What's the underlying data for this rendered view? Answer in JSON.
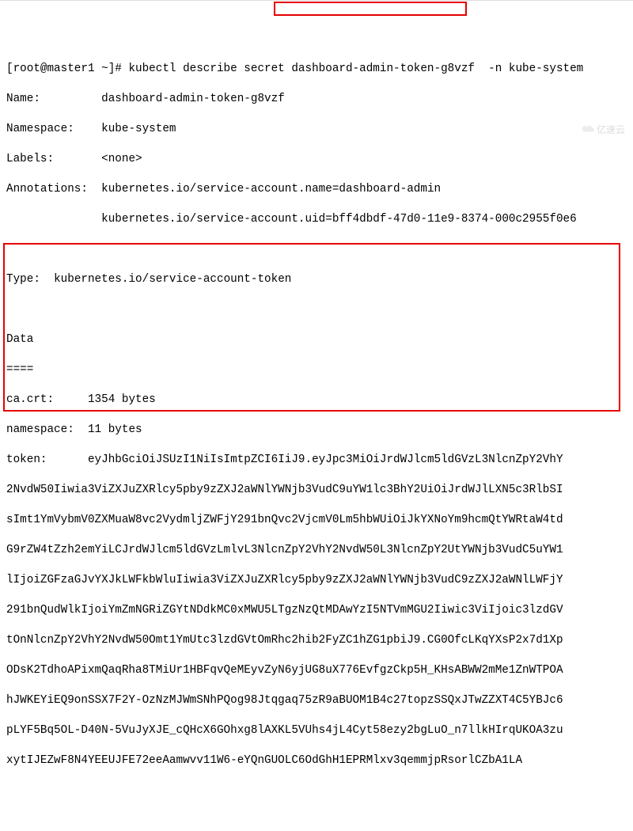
{
  "prompt": "[root@master1 ~]# ",
  "command": "kubectl describe secret dashboard-admin-token-g8vzf  -n kube-system",
  "fields": {
    "name_label": "Name:",
    "name_value": "dashboard-admin-token-g8vzf",
    "namespace_label": "Namespace:",
    "namespace_value": "kube-system",
    "labels_label": "Labels:",
    "labels_value": "<none>",
    "annotations_label": "Annotations:",
    "annotations_value1": "kubernetes.io/service-account.name=dashboard-admin",
    "annotations_value2": "kubernetes.io/service-account.uid=bff4dbdf-47d0-11e9-8374-000c2955f0e6",
    "type_label": "Type:",
    "type_value": "kubernetes.io/service-account-token",
    "data_header": "Data",
    "data_sep": "====",
    "cacrt_label": "ca.crt:",
    "cacrt_value": "1354 bytes",
    "ns_label": "namespace:",
    "ns_value": "11 bytes",
    "token_label": "token:",
    "token_lines": [
      "eyJhbGciOiJSUzI1NiIsImtpZCI6IiJ9.eyJpc3MiOiJrdWJlcm5ldGVzL3NlcnZpY2VhY",
      "2NvdW50Iiwia3ViZXJuZXRlcy5pby9zZXJ2aWNlYWNjb3VudC9uYW1lc3BhY2UiOiJrdWJlLXN5c3RlbSI",
      "sImt1YmVybmV0ZXMuaW8vc2VydmljZWFjY291bnQvc2VjcmV0Lm5hbWUiOiJkYXNoYm9hcmQtYWRtaW4td",
      "G9rZW4tZzh2emYiLCJrdWJlcm5ldGVzLmlvL3NlcnZpY2VhY2NvdW50L3NlcnZpY2UtYWNjb3VudC5uYW1",
      "lIjoiZGFzaGJvYXJkLWFkbWluIiwia3ViZXJuZXRlcy5pby9zZXJ2aWNlYWNjb3VudC9zZXJ2aWNlLWFjY",
      "291bnQudWlkIjoiYmZmNGRiZGYtNDdkMC0xMWU5LTgzNzQtMDAwYzI5NTVmMGU2Iiwic3ViIjoic3lzdGV",
      "tOnNlcnZpY2VhY2NvdW50Omt1YmUtc3lzdGVtOmRhc2hib2FyZC1hZG1pbiJ9.CG0OfcLKqYXsP2x7d1Xp",
      "ODsK2TdhoAPixmQaqRha8TMiUr1HBFqvQeMEyvZyN6yjUG8uX776EvfgzCkp5H_KHsABWW2mMe1ZnWTPOA",
      "hJWKEYiEQ9onSSX7F2Y-OzNzMJWmSNhPQog98Jtqgaq75zR9aBUOM1B4c27topzSSQxJTwZZXT4C5YBJc6",
      "pLYF5Bq5OL-D40N-5VuJyXJE_cQHcX6GOhxg8lAXKL5VUhs4jL4Cyt58ezy2bgLuO_n7llkHIrqUKOA3zu",
      "xytIJEZwF8N4YEEUJFE72eeAamwvv11W6-eYQnGUOLC6OdGhH1EPRMlxv3qemmjpRsorlCZbA1LA"
    ]
  },
  "watermark": "亿速云"
}
